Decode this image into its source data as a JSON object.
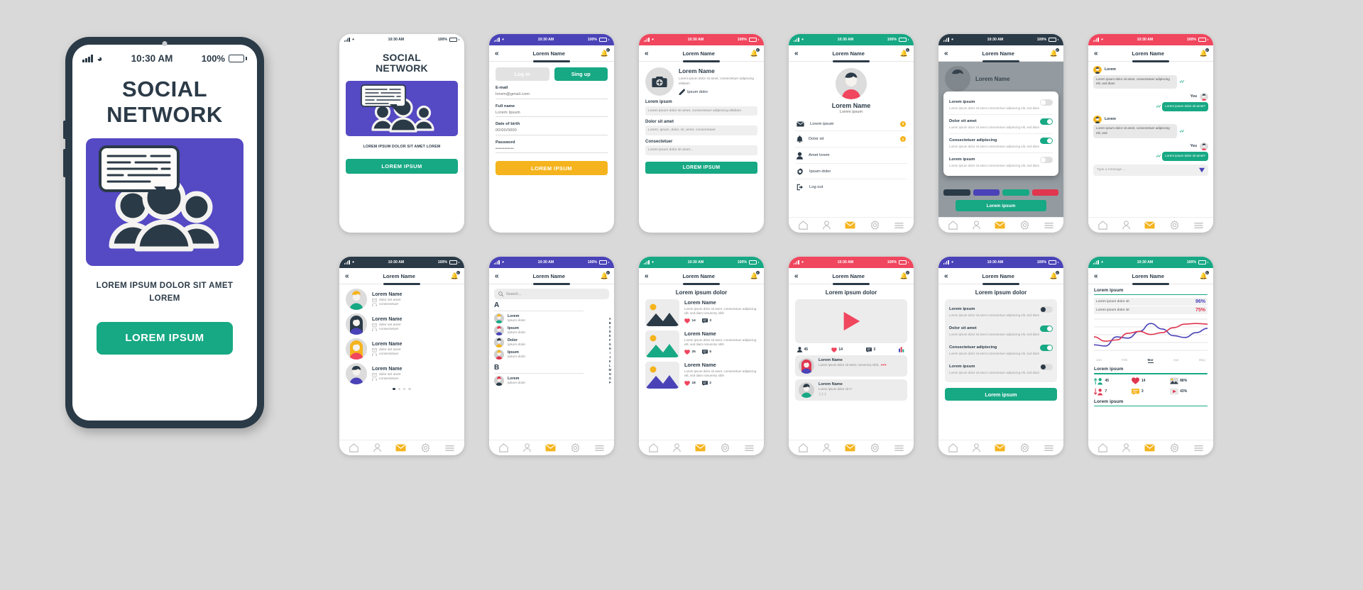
{
  "status_bar": {
    "time": "10:30 AM",
    "battery": "100%"
  },
  "hero_phone": {
    "title_line1": "SOCIAL",
    "title_line2": "NETWORK",
    "subtitle": "LOREM IPSUM DOLOR SIT AMET LOREM",
    "cta": "LOREM IPSUM"
  },
  "nav": {
    "title": "Lorem Name",
    "badge": "0",
    "back_icon": "chevron-double-left-icon",
    "bell_icon": "bell-icon"
  },
  "tabbar": {
    "home": "home-icon",
    "profile": "person-icon",
    "mail": "envelope-icon",
    "settings": "gear-icon",
    "menu": "hamburger-icon"
  },
  "screens": {
    "intro": {
      "name": "intro-screen",
      "accent": "#2b3a47",
      "title_line1": "SOCIAL",
      "title_line2": "NETWORK",
      "subtitle": "LOREM IPSUM DOLOR SIT AMET LOREM",
      "cta": "LOREM IPSUM"
    },
    "signup": {
      "name": "signup-screen",
      "accent": "#4a43b8",
      "tab_login": "Log in",
      "tab_signup": "Sing up",
      "fields": [
        {
          "label": "E-mail",
          "value": "lorem@gmail.com"
        },
        {
          "label": "Full name",
          "value": "Lorem Ipsum"
        },
        {
          "label": "Date of birth",
          "value": "00/00/0000"
        },
        {
          "label": "Password",
          "value": "••••••••••••"
        }
      ],
      "cta": "LOREM IPSUM"
    },
    "profile_edit": {
      "name": "profile-edit-screen",
      "accent": "#f0465e",
      "avatar_icon": "camera-add-icon",
      "display_name": "Lorem Name",
      "description": "Lorem ipsum dolor sit amet, consectetuer adipiscing elitdiam",
      "edit_icon": "pencil-icon",
      "edit_label": "Ipsum dolor",
      "fields": [
        {
          "label": "Lorem ipsum",
          "value": "Lorem ipsum dolor sit amet, consectetuer adipiscing elitdiam"
        },
        {
          "label": "Dolor sit amet",
          "value": "Lorem, ipsum, dolor, sit, amet, consectetuer"
        },
        {
          "label": "Consectetuer",
          "value": "Lorem ipsum dolor sit amet..."
        }
      ],
      "cta": "LOREM IPSUM"
    },
    "account": {
      "name": "account-menu-screen",
      "accent": "#17a884",
      "display_name": "Lorem Name",
      "subtitle": "Lorem ipsum",
      "items": [
        {
          "icon": "envelope-icon",
          "label": "Lorem ipsum",
          "badge": "3"
        },
        {
          "icon": "bell-icon",
          "label": "Dolor sit",
          "badge": "1"
        },
        {
          "icon": "person-icon",
          "label": "Amet lorem",
          "badge": ""
        },
        {
          "icon": "gear-icon",
          "label": "Ipsum dolor",
          "badge": ""
        },
        {
          "icon": "logout-icon",
          "label": "Log out",
          "badge": ""
        }
      ]
    },
    "settings_modal": {
      "name": "settings-modal-screen",
      "accent": "#2b3a47",
      "behind_name": "Lorem Name",
      "toggles": [
        {
          "title": "Lorem ipsum",
          "desc": "Lorem ipsum dolor sit amet consectetuer adipiscing elit, sed diam",
          "on": false
        },
        {
          "title": "Dolor sit amet",
          "desc": "Lorem ipsum dolor sit amet consectetuer adipiscing elit, sed diam",
          "on": true
        },
        {
          "title": "Consectetuer adipiscing",
          "desc": "Lorem ipsum dolor sit amet consectetuer adipiscing elit, sed diam",
          "on": true
        },
        {
          "title": "Lorem ipsum",
          "desc": "Lorem ipsum dolor sit amet consectetuer adipiscing elit, sed diam",
          "on": false
        }
      ],
      "cta": "Lorem ipsum"
    },
    "chat": {
      "name": "chat-screen",
      "accent": "#f0465e",
      "messages": [
        {
          "from": "Lorem",
          "side": "them",
          "text": "Lorem ipsum dolor sit amet, consectetuer adipiscing elit, sed diam"
        },
        {
          "from": "You",
          "side": "me",
          "text": "Lorem ipsum dolor sit amet?"
        },
        {
          "from": "Lorem",
          "side": "them",
          "text": "Lorem ipsum dolor sit amet, consectetuer adipiscing elit, sed"
        },
        {
          "from": "You",
          "side": "me",
          "text": "Lorem ipsum dolor sit amet?"
        }
      ],
      "input_placeholder": "Type a message ...",
      "send_icon": "send-icon"
    },
    "contacts": {
      "name": "contacts-screen",
      "accent": "#2b3a47",
      "rows": [
        {
          "name": "Lorem Name",
          "line1": "dolor set amet",
          "line2": "consectetuer"
        },
        {
          "name": "Lorem Name",
          "line1": "dolor set amet",
          "line2": "consectetuer"
        },
        {
          "name": "Lorem Name",
          "line1": "dolor set amet",
          "line2": "consectetuer"
        },
        {
          "name": "Lorem Name",
          "line1": "dolor set amet",
          "line2": "consectetuer"
        }
      ],
      "pager_count": 4,
      "pager_active": 0
    },
    "search": {
      "name": "search-directory-screen",
      "accent": "#4a43b8",
      "search_placeholder": "Search...",
      "search_icon": "search-icon",
      "groups": [
        {
          "letter": "A",
          "rows": [
            {
              "name": "Lorem",
              "sub": "Ipsum dolor"
            },
            {
              "name": "Ipsum",
              "sub": "Ipsum dolor"
            },
            {
              "name": "Dolor",
              "sub": "Ipsum dolor"
            },
            {
              "name": "Ipsum",
              "sub": "Ipsum dolor"
            }
          ]
        },
        {
          "letter": "B",
          "rows": [
            {
              "name": "Lorem",
              "sub": "Ipsum dolor"
            }
          ]
        }
      ],
      "index": [
        "A",
        "B",
        "C",
        "D",
        "E",
        "F",
        "G",
        "H",
        "I",
        "J",
        "K",
        "L",
        "M",
        "N",
        "O",
        "P"
      ]
    },
    "feed": {
      "name": "feed-screen",
      "accent": "#17a884",
      "heading": "Lorem ipsum dolor",
      "posts": [
        {
          "title": "Lorem Name",
          "text": "Lorem ipsum dolor sit amet, consectetuer adipiscing elit, sed diam nonummy nibh",
          "likes": "14",
          "comments": "3",
          "img_color": "#2b3a47"
        },
        {
          "title": "Lorem Name",
          "text": "Lorem ipsum dolor sit amet, consectetuer adipiscing elit, sed diam nonummy nibh",
          "likes": "25",
          "comments": "5",
          "img_color": "#17a884"
        },
        {
          "title": "Lorem Name",
          "text": "Lorem ipsum dolor sit amet, consectetuer adipiscing elit, sed diam nonummy nibh",
          "likes": "18",
          "comments": "2",
          "img_color": "#4a43b8"
        }
      ]
    },
    "video": {
      "name": "video-screen",
      "accent": "#f0465e",
      "heading": "Lorem ipsum dolor",
      "play_icon": "play-icon",
      "stats": [
        {
          "icon": "person-icon",
          "value": "45"
        },
        {
          "icon": "heart-icon",
          "value": "14"
        },
        {
          "icon": "comment-icon",
          "value": "3"
        },
        {
          "icon": "bars-icon",
          "value": ""
        }
      ],
      "comments": [
        {
          "name": "Lorem Name",
          "text": "Lorem ipsum dolor sit amet, nonummy nibh...",
          "emoji": "♥♥♥"
        },
        {
          "name": "Lorem Name",
          "text": "Lorem ipsum dolor sit !!!",
          "emoji": ":) :) :)"
        }
      ]
    },
    "settings": {
      "name": "settings-screen",
      "accent": "#4a43b8",
      "heading": "Lorem ipsum dolor",
      "toggles": [
        {
          "title": "Lorem ipsum",
          "desc": "Lorem ipsum dolor sit amet consectetuer adipiscing elit, sed diam",
          "on": false
        },
        {
          "title": "Dolor sit amet",
          "desc": "Lorem ipsum dolor sit amet consectetuer adipiscing elit, sed diam",
          "on": true
        },
        {
          "title": "Consectetuer adipiscing",
          "desc": "Lorem ipsum dolor sit amet consectetuer adipiscing elit, sed diam",
          "on": true
        },
        {
          "title": "Lorem ipsum",
          "desc": "Lorem ipsum dolor sit amet consectetuer adipiscing elit, sed diam",
          "on": false
        }
      ],
      "cta": "Lorem ipsum"
    },
    "analytics": {
      "name": "analytics-screen",
      "accent": "#17a884",
      "section1": "Lorem ipsum",
      "stats": [
        {
          "label": "Lorem ipsum dolor sit",
          "value": "96%",
          "color": "#4a43b8"
        },
        {
          "label": "Lorem ipsum dolor sit",
          "value": "75%",
          "color": "#e0364f"
        }
      ],
      "section2": "Lorem ipsum",
      "section3": "Lorem ipsum",
      "kpis": [
        {
          "icon": "arrow-up-person-icon",
          "value": "45"
        },
        {
          "icon": "heart-icon",
          "value": "14"
        },
        {
          "icon": "image-icon",
          "value": "88%"
        },
        {
          "icon": "arrow-down-person-icon",
          "value": "7"
        },
        {
          "icon": "comment-icon",
          "value": "3"
        },
        {
          "icon": "play-icon",
          "value": "43%"
        }
      ]
    }
  },
  "chart_data": {
    "type": "line",
    "title": "Lorem ipsum",
    "x": [
      "Jan",
      "Feb",
      "Mar",
      "Apr",
      "May"
    ],
    "current_month": "Mar",
    "grid": true,
    "ylim": [
      0,
      100
    ],
    "series": [
      {
        "name": "Lorem ipsum dolor sit",
        "color": "#4a43b8",
        "value_label": "96%",
        "values": [
          18,
          14,
          44,
          40,
          62,
          88,
          70,
          48,
          42,
          58,
          72
        ]
      },
      {
        "name": "Lorem ipsum dolor sit",
        "color": "#e0364f",
        "value_label": "75%",
        "values": [
          44,
          30,
          34,
          56,
          62,
          52,
          58,
          74,
          86,
          88,
          86
        ]
      }
    ]
  },
  "colors": {
    "dark": "#2b3a47",
    "purple": "#4a43b8",
    "indigo": "#5549c4",
    "teal": "#17a884",
    "red": "#f0465e",
    "crimson": "#e0364f",
    "yellow": "#f5b41d",
    "page_bg": "#d9d9d9"
  }
}
